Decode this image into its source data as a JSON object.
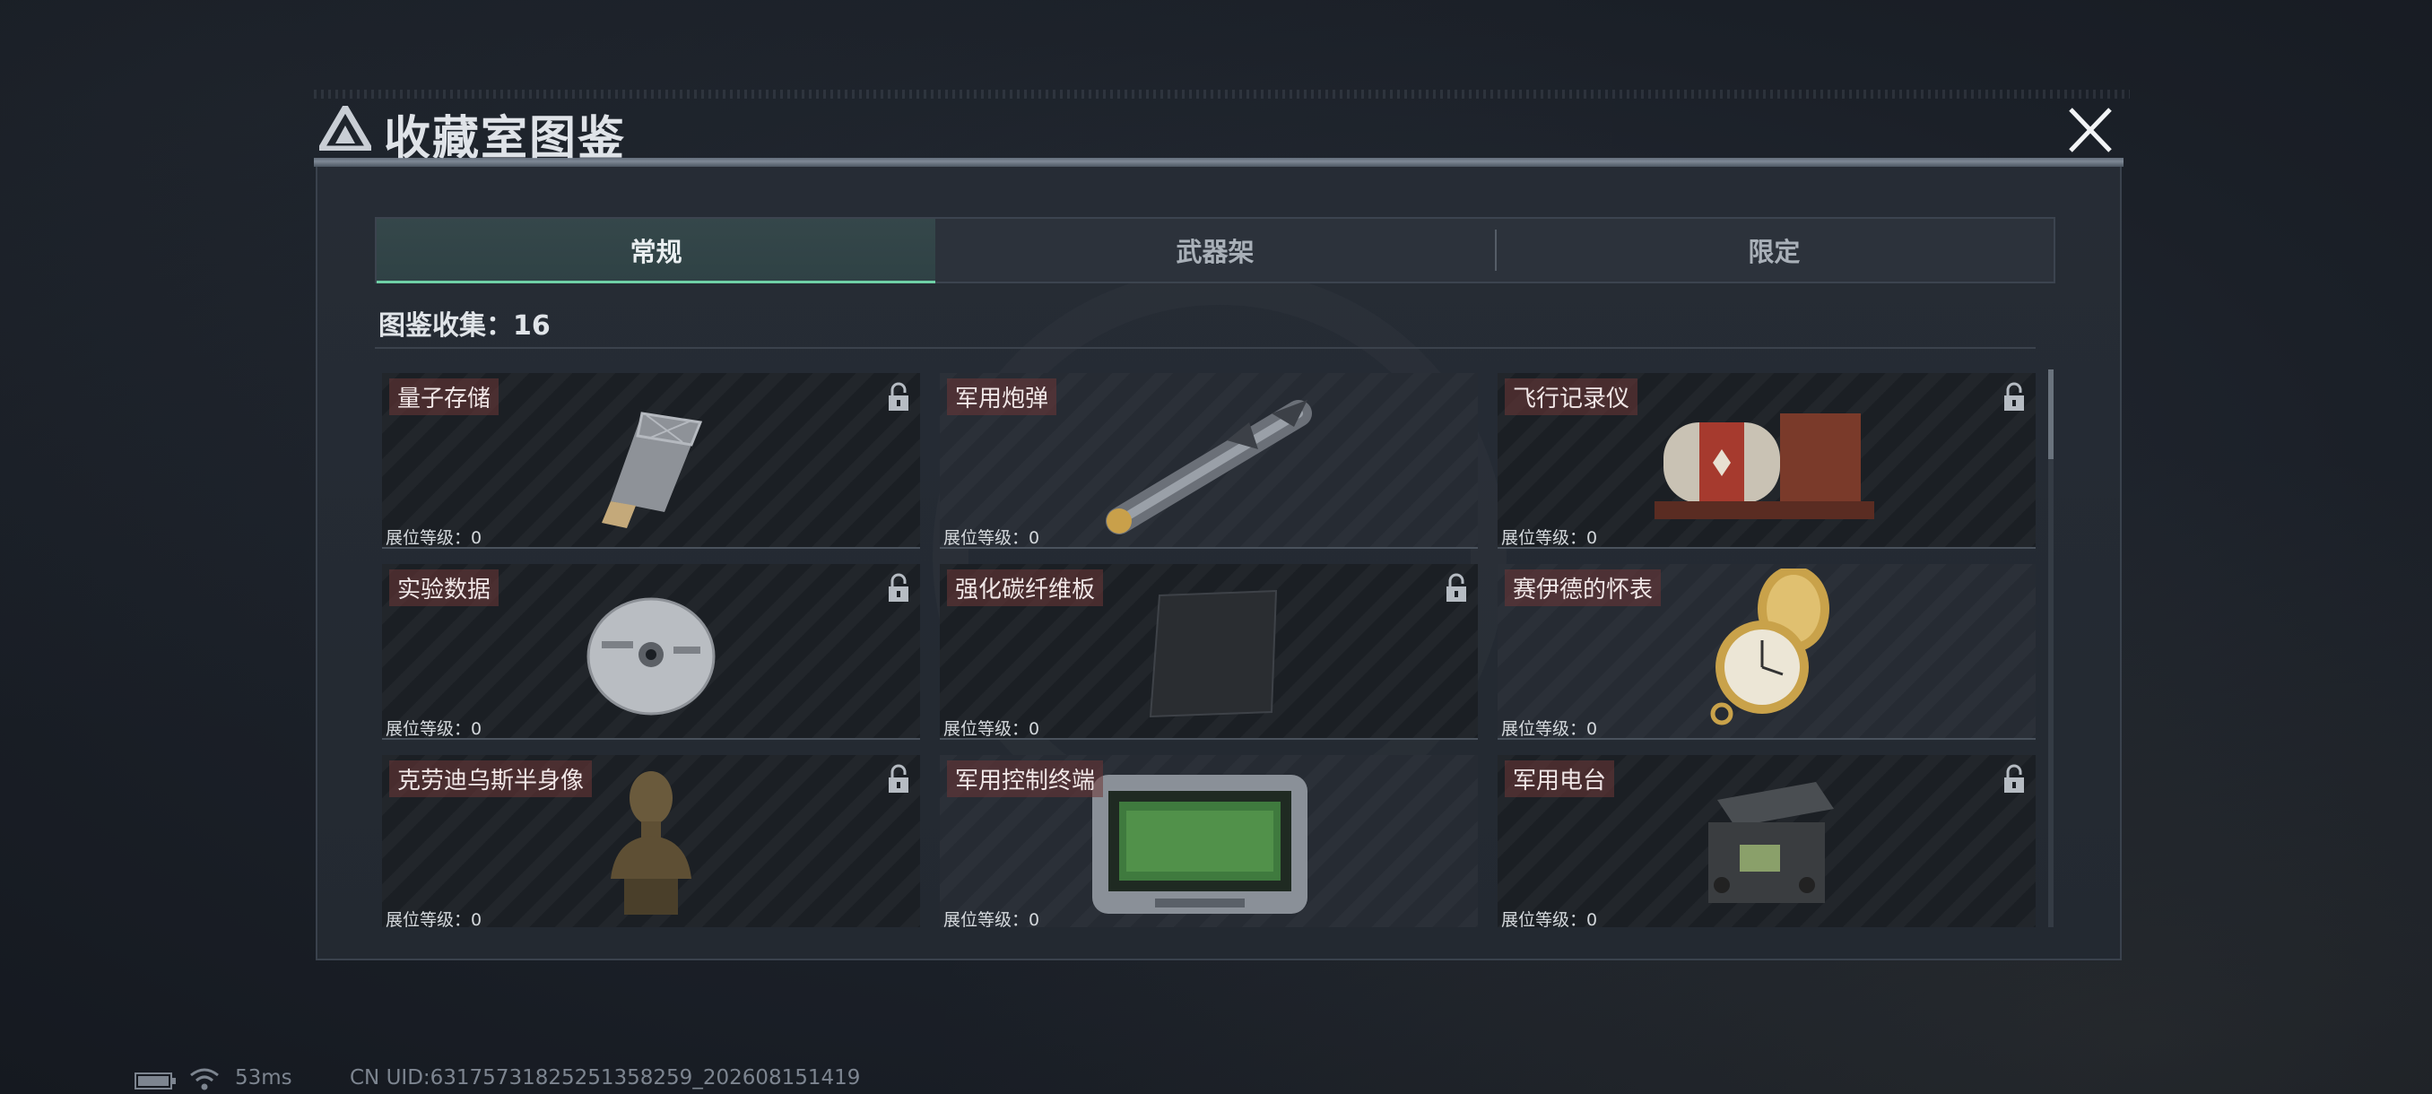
{
  "title": "收藏室图鉴",
  "tabs": [
    {
      "label": "常规",
      "active": true
    },
    {
      "label": "武器架",
      "active": false
    },
    {
      "label": "限定",
      "active": false
    }
  ],
  "collection_count_label": "图鉴收集：",
  "collection_count": "16",
  "level_label": "展位等级：0",
  "items": [
    {
      "name": "量子存储",
      "locked": true,
      "icon": "usb-drive-icon"
    },
    {
      "name": "军用炮弹",
      "locked": false,
      "icon": "missile-icon"
    },
    {
      "name": "飞行记录仪",
      "locked": true,
      "icon": "flight-recorder-icon"
    },
    {
      "name": "实验数据",
      "locked": true,
      "icon": "disc-icon"
    },
    {
      "name": "强化碳纤维板",
      "locked": true,
      "icon": "carbon-plate-icon"
    },
    {
      "name": "赛伊德的怀表",
      "locked": false,
      "icon": "pocket-watch-icon"
    },
    {
      "name": "克劳迪乌斯半身像",
      "locked": true,
      "icon": "bust-icon"
    },
    {
      "name": "军用控制终端",
      "locked": false,
      "icon": "control-terminal-icon"
    },
    {
      "name": "军用电台",
      "locked": true,
      "icon": "radio-icon"
    }
  ],
  "status": {
    "ping": "53ms",
    "uid": "CN UID:6317573182525135825​9_202608151419"
  }
}
